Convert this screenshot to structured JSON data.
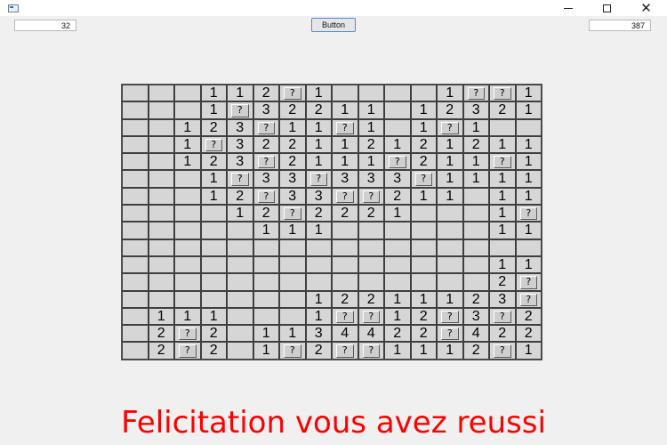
{
  "window": {
    "minimize_glyph": "minimize",
    "maximize_glyph": "maximize",
    "close_glyph": "✕"
  },
  "toolbar": {
    "left_counter": "32",
    "button_label": "Button",
    "right_counter": "387"
  },
  "board": {
    "columns": 16,
    "rows": [
      [
        "",
        "",
        "",
        "1",
        "1",
        "2",
        "?",
        "1",
        "",
        "",
        "",
        "",
        "1",
        "?",
        "?",
        "1"
      ],
      [
        "",
        "",
        "",
        "1",
        "?",
        "3",
        "2",
        "2",
        "1",
        "1",
        "",
        "1",
        "2",
        "3",
        "2",
        "1"
      ],
      [
        "",
        "",
        "1",
        "2",
        "3",
        "?",
        "1",
        "1",
        "?",
        "1",
        "",
        "1",
        "?",
        "1",
        "",
        ""
      ],
      [
        "",
        "",
        "1",
        "?",
        "3",
        "2",
        "2",
        "1",
        "1",
        "2",
        "1",
        "2",
        "1",
        "2",
        "1",
        "1"
      ],
      [
        "",
        "",
        "1",
        "2",
        "3",
        "?",
        "2",
        "1",
        "1",
        "1",
        "?",
        "2",
        "1",
        "1",
        "?",
        "1"
      ],
      [
        "",
        "",
        "",
        "1",
        "?",
        "3",
        "3",
        "?",
        "3",
        "3",
        "3",
        "?",
        "1",
        "1",
        "1",
        "1"
      ],
      [
        "",
        "",
        "",
        "1",
        "2",
        "?",
        "3",
        "3",
        "?",
        "?",
        "2",
        "1",
        "1",
        "",
        "1",
        "1"
      ],
      [
        "",
        "",
        "",
        "",
        "1",
        "2",
        "?",
        "2",
        "2",
        "2",
        "1",
        "",
        "",
        "",
        "1",
        "?"
      ],
      [
        "",
        "",
        "",
        "",
        "",
        "1",
        "1",
        "1",
        "",
        "",
        "",
        "",
        "",
        "",
        "1",
        "1"
      ],
      [
        "",
        "",
        "",
        "",
        "",
        "",
        "",
        "",
        "",
        "",
        "",
        "",
        "",
        "",
        "",
        ""
      ],
      [
        "",
        "",
        "",
        "",
        "",
        "",
        "",
        "",
        "",
        "",
        "",
        "",
        "",
        "",
        "1",
        "1"
      ],
      [
        "",
        "",
        "",
        "",
        "",
        "",
        "",
        "",
        "",
        "",
        "",
        "",
        "",
        "",
        "2",
        "?"
      ],
      [
        "",
        "",
        "",
        "",
        "",
        "",
        "",
        "1",
        "2",
        "2",
        "1",
        "1",
        "1",
        "2",
        "3",
        "?"
      ],
      [
        "",
        "1",
        "1",
        "1",
        "",
        "",
        "",
        "1",
        "?",
        "?",
        "1",
        "2",
        "?",
        "3",
        "?",
        "2"
      ],
      [
        "",
        "2",
        "?",
        "2",
        "",
        "1",
        "1",
        "3",
        "4",
        "4",
        "2",
        "2",
        "?",
        "4",
        "2",
        "2"
      ],
      [
        "",
        "2",
        "?",
        "2",
        "",
        "1",
        "?",
        "2",
        "?",
        "?",
        "1",
        "1",
        "1",
        "2",
        "?",
        "1"
      ]
    ]
  },
  "message": "Felicitation vous avez reussi",
  "colors": {
    "message": "#ff0000",
    "cell": "#d6d6d6",
    "button_border": "#4c8fd6"
  }
}
